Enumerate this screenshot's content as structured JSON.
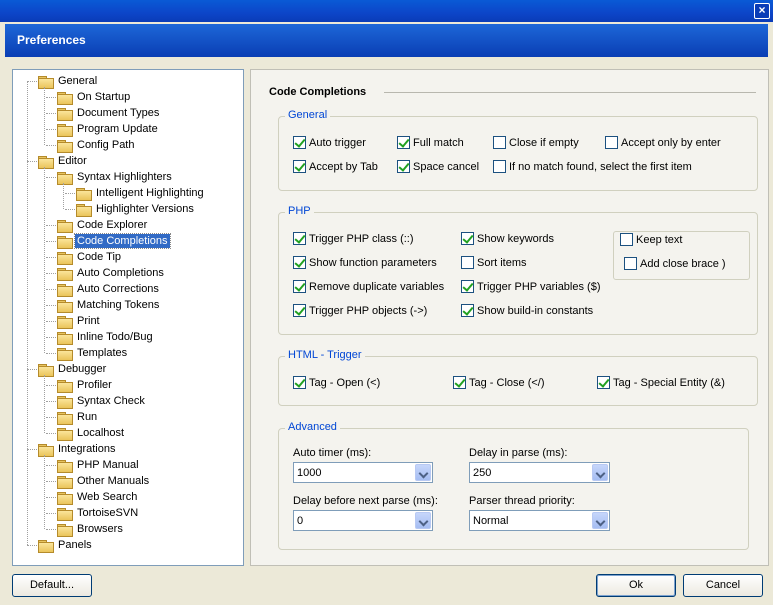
{
  "window": {
    "title": "Preferences",
    "close_glyph": "×"
  },
  "tree": [
    {
      "label": "General",
      "depth": 0
    },
    {
      "label": "On Startup",
      "depth": 1
    },
    {
      "label": "Document Types",
      "depth": 1
    },
    {
      "label": "Program Update",
      "depth": 1
    },
    {
      "label": "Config Path",
      "depth": 1
    },
    {
      "label": "Editor",
      "depth": 0
    },
    {
      "label": "Syntax Highlighters",
      "depth": 1
    },
    {
      "label": "Intelligent Highlighting",
      "depth": 2
    },
    {
      "label": "Highlighter Versions",
      "depth": 2
    },
    {
      "label": "Code Explorer",
      "depth": 1
    },
    {
      "label": "Code Completions",
      "depth": 1,
      "selected": true
    },
    {
      "label": "Code Tip",
      "depth": 1
    },
    {
      "label": "Auto Completions",
      "depth": 1
    },
    {
      "label": "Auto Corrections",
      "depth": 1
    },
    {
      "label": "Matching Tokens",
      "depth": 1
    },
    {
      "label": "Print",
      "depth": 1
    },
    {
      "label": "Inline Todo/Bug",
      "depth": 1
    },
    {
      "label": "Templates",
      "depth": 1
    },
    {
      "label": "Debugger",
      "depth": 0
    },
    {
      "label": "Profiler",
      "depth": 1
    },
    {
      "label": "Syntax Check",
      "depth": 1
    },
    {
      "label": "Run",
      "depth": 1
    },
    {
      "label": "Localhost",
      "depth": 1
    },
    {
      "label": "Integrations",
      "depth": 0
    },
    {
      "label": "PHP Manual",
      "depth": 1
    },
    {
      "label": "Other Manuals",
      "depth": 1
    },
    {
      "label": "Web Search",
      "depth": 1
    },
    {
      "label": "TortoiseSVN",
      "depth": 1
    },
    {
      "label": "Browsers",
      "depth": 1
    },
    {
      "label": "Panels",
      "depth": 0
    }
  ],
  "pane": {
    "title": "Code Completions",
    "general": {
      "title": "General",
      "options": [
        {
          "label": "Auto trigger",
          "checked": true
        },
        {
          "label": "Full match",
          "checked": true
        },
        {
          "label": "Close if empty",
          "checked": false
        },
        {
          "label": "Accept only by enter",
          "checked": false
        },
        {
          "label": "Accept by Tab",
          "checked": true
        },
        {
          "label": "Space cancel",
          "checked": true
        },
        {
          "label": "If no match found, select the first item",
          "checked": false
        }
      ]
    },
    "php": {
      "title": "PHP",
      "options": [
        {
          "label": "Trigger PHP class (::)",
          "checked": true
        },
        {
          "label": "Show function parameters",
          "checked": true
        },
        {
          "label": "Remove duplicate variables",
          "checked": true
        },
        {
          "label": "Trigger PHP objects (->)",
          "checked": true
        },
        {
          "label": "Show keywords",
          "checked": true
        },
        {
          "label": "Sort items",
          "checked": false
        },
        {
          "label": "Trigger PHP variables ($)",
          "checked": true
        },
        {
          "label": "Show build-in constants",
          "checked": true
        },
        {
          "label": "Keep text",
          "checked": false
        },
        {
          "label": "Add close brace )",
          "checked": false
        }
      ]
    },
    "html": {
      "title": "HTML - Trigger",
      "options": [
        {
          "label": "Tag - Open (<)",
          "checked": true
        },
        {
          "label": "Tag - Close (</)",
          "checked": true
        },
        {
          "label": "Tag - Special Entity (&)",
          "checked": true
        }
      ]
    },
    "advanced": {
      "title": "Advanced",
      "auto_timer_label": "Auto timer (ms):",
      "auto_timer_value": "1000",
      "delay_parse_label": "Delay in parse (ms):",
      "delay_parse_value": "250",
      "delay_next_label": "Delay before next parse (ms):",
      "delay_next_value": "0",
      "priority_label": "Parser thread priority:",
      "priority_value": "Normal"
    }
  },
  "buttons": {
    "default": "Default...",
    "ok": "Ok",
    "cancel": "Cancel"
  }
}
